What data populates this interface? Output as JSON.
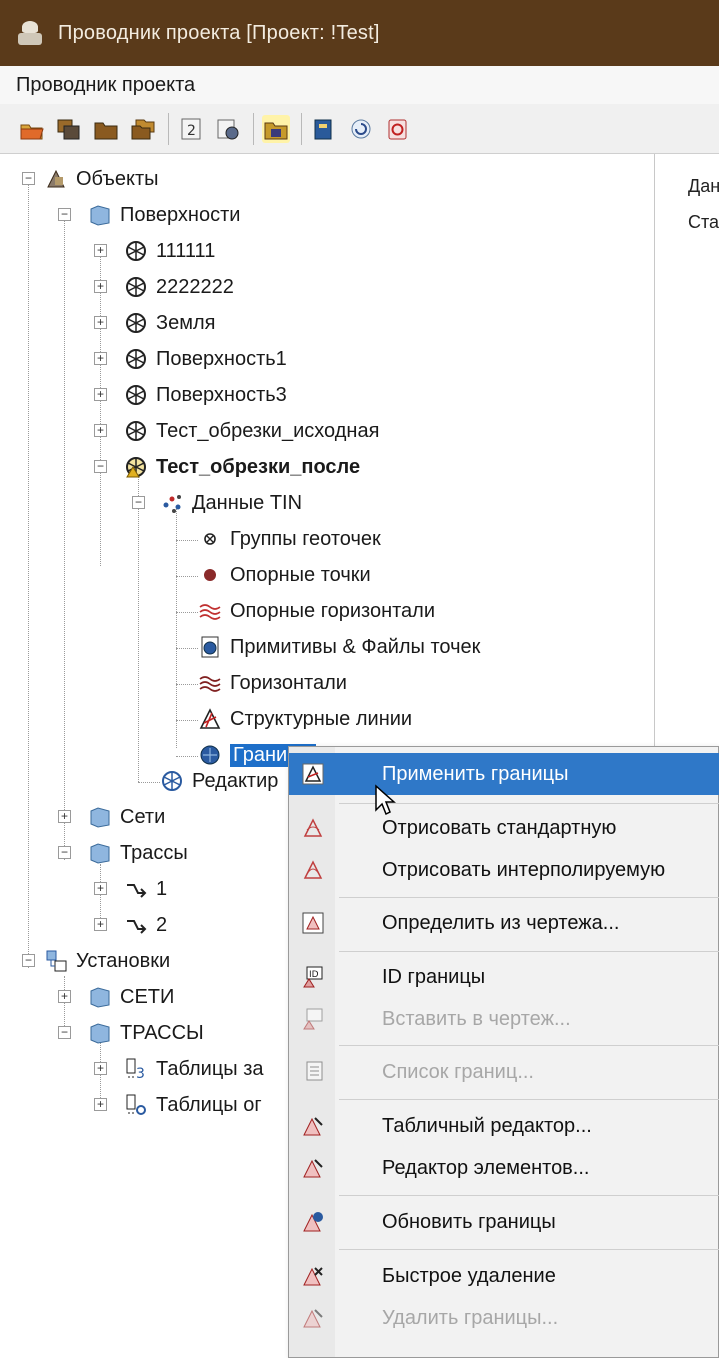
{
  "window": {
    "title": "Проводник проекта [Проект: !Test]"
  },
  "panel": {
    "header": "Проводник проекта"
  },
  "right_pane": {
    "line1": "Дан",
    "line2": "Ста"
  },
  "tree": {
    "objects": "Объекты",
    "surfaces": "Поверхности",
    "s1": "111111",
    "s2": "2222222",
    "s3": "Земля",
    "s4": "Поверхность1",
    "s5": "Поверхность3",
    "s6": "Тест_обрезки_исходная",
    "s7": "Тест_обрезки_после",
    "tin": "Данные TIN",
    "t1": "Группы геоточек",
    "t2": "Опорные точки",
    "t3": "Опорные горизонтали",
    "t4": "Примитивы & Файлы точек",
    "t5": "Горизонтали",
    "t6": "Структурные линии",
    "t7": "Границы",
    "edit": "Редактир",
    "nets": "Сети",
    "routes": "Трассы",
    "r1": "1",
    "r2": "2",
    "settings": "Установки",
    "nets_caps": "СЕТИ",
    "routes_caps": "ТРАССЫ",
    "tables1": "Таблицы за",
    "tables2": "Таблицы ог"
  },
  "context_menu": {
    "items": [
      {
        "label": "Применить границы",
        "highlighted": true,
        "disabled": false
      },
      {
        "label": "Отрисовать стандартную",
        "disabled": false
      },
      {
        "label": "Отрисовать интерполируемую",
        "disabled": false
      },
      {
        "label": "Определить из чертежа...",
        "disabled": false
      },
      {
        "label": "ID границы",
        "disabled": false
      },
      {
        "label": "Вставить в чертеж...",
        "disabled": true
      },
      {
        "label": "Список границ...",
        "disabled": true
      },
      {
        "label": "Табличный редактор...",
        "disabled": false
      },
      {
        "label": "Редактор элементов...",
        "disabled": false
      },
      {
        "label": "Обновить границы",
        "disabled": false
      },
      {
        "label": "Быстрое удаление",
        "disabled": false
      },
      {
        "label": "Удалить границы...",
        "disabled": true
      }
    ]
  },
  "colors": {
    "titlebar": "#5a3a1a",
    "selection": "#1e6fc9",
    "menu_highlight": "#2f78c8"
  }
}
